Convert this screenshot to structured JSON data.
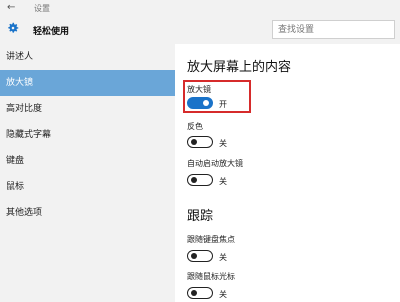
{
  "window": {
    "title": "设置",
    "back_glyph": "←"
  },
  "header": {
    "section_title": "轻松使用",
    "search_placeholder": "查找设置"
  },
  "sidebar": {
    "items": [
      {
        "label": "讲述人",
        "selected": false
      },
      {
        "label": "放大镜",
        "selected": true
      },
      {
        "label": "高对比度",
        "selected": false
      },
      {
        "label": "隐藏式字幕",
        "selected": false
      },
      {
        "label": "键盘",
        "selected": false
      },
      {
        "label": "鼠标",
        "selected": false
      },
      {
        "label": "其他选项",
        "selected": false
      }
    ]
  },
  "main": {
    "heading_magnify": "放大屏幕上的内容",
    "magnifier": {
      "label": "放大镜",
      "state_text": "开",
      "on": true
    },
    "invert": {
      "label": "反色",
      "state_text": "关",
      "on": false
    },
    "autostart": {
      "label": "自动启动放大镜",
      "state_text": "关",
      "on": false
    },
    "heading_tracking": "跟踪",
    "follow_keyboard": {
      "label": "跟随键盘焦点",
      "state_text": "关",
      "on": false
    },
    "follow_mouse": {
      "label": "跟随鼠标光标",
      "state_text": "关",
      "on": false
    }
  },
  "colors": {
    "accent": "#1a73c9",
    "selected_nav": "#6aa6d8",
    "highlight_border": "#d62b2b",
    "sidebar_bg": "#f2f2f2"
  }
}
